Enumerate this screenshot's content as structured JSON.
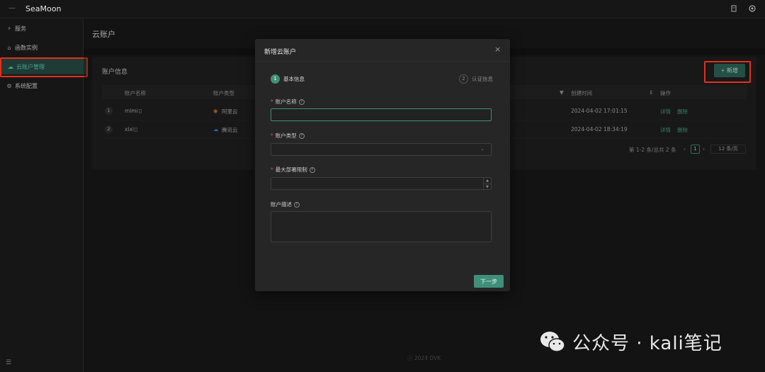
{
  "app": {
    "title": "SeaMoon"
  },
  "sidebar": {
    "items": [
      {
        "label": "服务",
        "icon": "service-icon"
      },
      {
        "label": "函数实例",
        "icon": "instance-icon"
      },
      {
        "label": "云账户管理",
        "icon": "cloud-icon",
        "active": true
      },
      {
        "label": "系统配置",
        "icon": "gear-icon"
      }
    ]
  },
  "page": {
    "title": "云账户"
  },
  "card": {
    "title": "账户信息",
    "add_label": "新增",
    "columns": {
      "name": "账户名称",
      "type": "账户类型",
      "created": "创建时间",
      "actions": "操作"
    },
    "rows": [
      {
        "index": "1",
        "name": "mimi",
        "type": "阿里云",
        "created": "2024-04-02 17:01:15",
        "detail": "详情",
        "delete": "删除"
      },
      {
        "index": "2",
        "name": "xixi",
        "type": "腾讯云",
        "created": "2024-04-02 18:34:19",
        "detail": "详情",
        "delete": "删除"
      }
    ],
    "pagination": {
      "summary": "第 1-2 条/总共 2 条",
      "prev": "‹",
      "current": "1",
      "next": "›",
      "page_size": "12 条/页"
    }
  },
  "footer": {
    "text": "ⓒ 2024 DVK"
  },
  "modal": {
    "title": "新增云账户",
    "close": "×",
    "steps": [
      {
        "num": "1",
        "label": "基本信息"
      },
      {
        "num": "2",
        "label": "认证信息"
      }
    ],
    "fields": {
      "name_label": "账户名称",
      "type_label": "账户类型",
      "limit_label": "最大部署限制",
      "desc_label": "账户描述"
    },
    "required_mark": "*",
    "help_mark": "?",
    "next_label": "下一步"
  },
  "watermark": {
    "text": "公众号 · kali笔记"
  },
  "colors": {
    "accent": "#3f8f7a",
    "highlight": "#e0301e",
    "danger": "#e04a3a"
  }
}
